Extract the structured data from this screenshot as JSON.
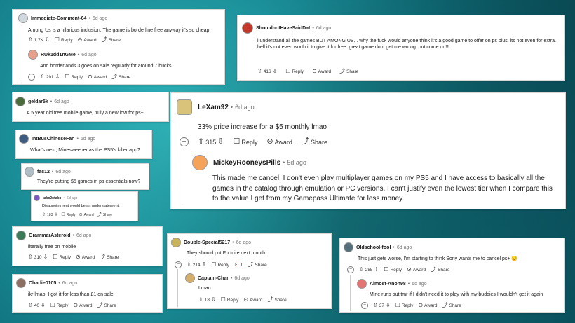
{
  "icons": {
    "upvote": "⇧",
    "downvote": "⇩",
    "reply": "☐",
    "award": "⊙",
    "share": "⤴",
    "collapse": "−"
  },
  "labels": {
    "reply": "Reply",
    "award": "Award",
    "share": "Share"
  },
  "cards": {
    "c1": {
      "user": "Immediate-Comment-64",
      "age": "6d ago",
      "text": "Among Us is a hilarious inclusion. The game is borderline free anyway it's so cheap.",
      "votes": "1.7K",
      "reply": {
        "user": "RUk1dd1nGMe",
        "age": "6d ago",
        "text": "And borderlands 3 goes on sale regularly for around 7 bucks",
        "votes": "291"
      }
    },
    "c2": {
      "user": "ShouldnotHaveSaidDat",
      "age": "6d ago",
      "text": "i understand all the games BUT AMONG US... why the fuck would anyone think it's a good game to offer on ps plus. its not even for extra. hell it's not even worth it to give it for free. great game dont get me wrong. but come on!!!",
      "votes": "416"
    },
    "c3": {
      "user": "geldar5k",
      "age": "6d ago",
      "text": "A 5 year old free mobile game, truly a new low for ps+."
    },
    "c4": {
      "user": "IntBusChineseFan",
      "age": "6d ago",
      "text": "What's next, Minesweeper as the PS5's killer app?"
    },
    "c5": {
      "user": "fac12",
      "age": "6d ago",
      "text": "They're putting $5 games in ps essentials now?"
    },
    "c6": {
      "user": "tako2otako",
      "age": "6d ago",
      "text": "Disappointment would be an understatement.",
      "votes": "183"
    },
    "c7": {
      "user": "LeXam92",
      "age": "6d ago",
      "text": "33% price increase for a $5 monthly lmao",
      "votes": "315",
      "reply": {
        "user": "MickeyRooneysPills",
        "age": "5d ago",
        "text": "This made me cancel. I don't even play multiplayer games on my PS5 and I have access to basically all the games in the catalog through emulation or PC versions. I can't justify even the lowest tier when I compare this to the value I get from my Gamepass Ultimate for less money."
      }
    },
    "c8": {
      "user": "GrammarAsteroid",
      "age": "6d ago",
      "text": "literally free on mobile",
      "votes": "310"
    },
    "c9": {
      "user": "Charlie0105",
      "age": "6d ago",
      "text": "ikr lmao. I got it for less than £1 on sale",
      "votes": "40"
    },
    "c10": {
      "user": "Double-Special5217",
      "age": "6d ago",
      "text": "They should put Fortnite next month",
      "votes": "214",
      "award_count": "1",
      "reply": {
        "user": "Captain-Char",
        "age": "6d ago",
        "text": "Lmao",
        "votes": "18"
      }
    },
    "c11": {
      "user": "Oldschool-fool",
      "age": "6d ago",
      "text": "This just gets worse, I'm starting to think Sony wants me to cancel ps+ 😔",
      "votes": "285",
      "reply": {
        "user": "Almost-Anon98",
        "age": "6d ago",
        "text": "Mine runs out tmr if I didn't need it to play with my buddies I wouldn't get it again",
        "votes": "37"
      }
    }
  }
}
